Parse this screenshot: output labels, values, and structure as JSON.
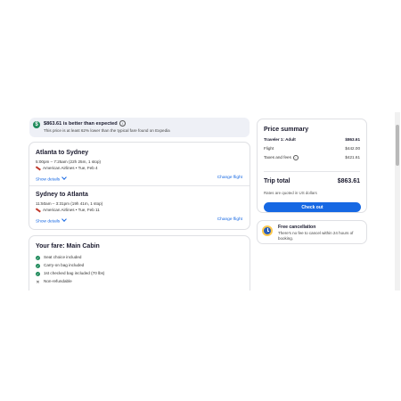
{
  "banner": {
    "title": "$863.61 is better than expected",
    "subtitle": "This price is at least 62% lower than the typical fare found on Expedia"
  },
  "flights": [
    {
      "route": "Atlanta to Sydney",
      "times": "5:00pm – 7:25am (22h 25m, 1 stop)",
      "airline_date": "American Airlines • Tue, Feb 4",
      "show_details": "Show details",
      "change": "Change flight"
    },
    {
      "route": "Sydney to Atlanta",
      "times": "11:50am – 3:31pm (19h 41m, 1 stop)",
      "airline_date": "American Airlines • Tue, Feb 11",
      "show_details": "Show details",
      "change": "Change flight"
    }
  ],
  "fare": {
    "title": "Your fare: Main Cabin",
    "items": [
      {
        "label": "Seat choice included",
        "included": true
      },
      {
        "label": "Carry-on bag included",
        "included": true
      },
      {
        "label": "1st checked bag included (70 lbs)",
        "included": true
      },
      {
        "label": "Non-refundable",
        "included": false
      }
    ]
  },
  "price_summary": {
    "title": "Price summary",
    "traveler_label": "Traveler 1: Adult",
    "traveler_value": "$863.61",
    "flight_label": "Flight",
    "flight_value": "$442.00",
    "taxes_label": "Taxes and fees",
    "taxes_value": "$421.61",
    "total_label": "Trip total",
    "total_value": "$863.61",
    "currency_note": "Rates are quoted in US dollars",
    "checkout_label": "Check out"
  },
  "cancellation": {
    "title": "Free cancellation",
    "text": "There's no fee to cancel within 24 hours of booking."
  },
  "colors": {
    "accent": "#1668e3",
    "success": "#1f8a5b",
    "banner_bg": "#eef0f6"
  }
}
